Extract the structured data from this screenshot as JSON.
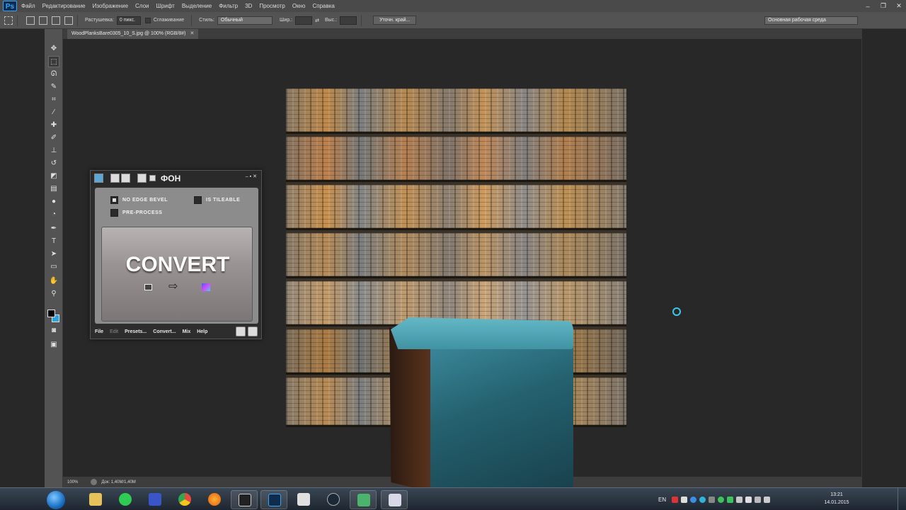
{
  "app": {
    "logo": "Ps",
    "menu": [
      "Файл",
      "Редактирование",
      "Изображение",
      "Слои",
      "Шрифт",
      "Выделение",
      "Фильтр",
      "3D",
      "Просмотр",
      "Окно",
      "Справка"
    ]
  },
  "options": {
    "feather_label": "Растушевка:",
    "feather_value": "0 пикс.",
    "antialias_label": "Сглаживание",
    "style_label": "Стиль:",
    "style_value": "Обычный",
    "width_label": "Шир.:",
    "height_label": "Выс.:",
    "refine_button": "Уточн. край...",
    "workspace": "Основная рабочая среда"
  },
  "document": {
    "tab_title": "WoodPlanksBare0305_10_S.jpg @ 100% (RGB/8#)",
    "zoom": "100%",
    "doc_size": "Док: 1,40M/1,40M"
  },
  "plugin": {
    "title": "ФОН",
    "no_edge_bevel": "NO EDGE BEVEL",
    "is_tileable": "IS TILEABLE",
    "pre_process": "PRE-PROCESS",
    "convert": "CONVERT",
    "menu": [
      "File",
      "Edit",
      "Presets...",
      "Convert...",
      "Mix",
      "Help"
    ]
  },
  "taskbar": {
    "lang": "EN",
    "time": "13:21",
    "date": "14.01.2015"
  },
  "colors": {
    "accent": "#31a8ff",
    "cube": "#3d8da0",
    "bg_color": "#2aa4dd"
  }
}
